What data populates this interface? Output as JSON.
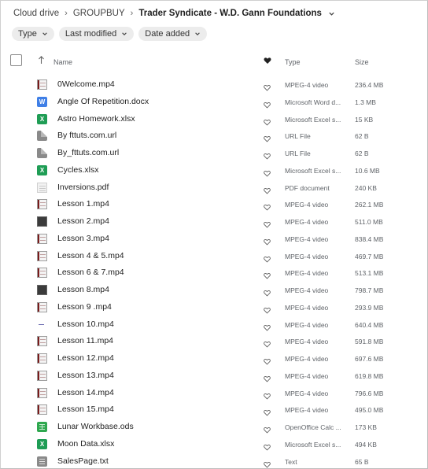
{
  "breadcrumb": {
    "items": [
      "Cloud drive",
      "GROUPBUY"
    ],
    "current": "Trader Syndicate - W.D. Gann Foundations"
  },
  "filters": [
    "Type",
    "Last modified",
    "Date added"
  ],
  "columns": {
    "name": "Name",
    "type": "Type",
    "size": "Size"
  },
  "files": [
    {
      "name": "0Welcome.mp4",
      "type": "MPEG-4 video",
      "size": "236.4 MB",
      "icon": "video-file-icon"
    },
    {
      "name": "Angle Of Repetition.docx",
      "type": "Microsoft Word d...",
      "size": "1.3 MB",
      "icon": "word-file-icon"
    },
    {
      "name": "Astro Homework.xlsx",
      "type": "Microsoft Excel s...",
      "size": "15 KB",
      "icon": "excel-file-icon"
    },
    {
      "name": "By fttuts.com.url",
      "type": "URL File",
      "size": "62 B",
      "icon": "url-file-icon"
    },
    {
      "name": "By_fttuts.com.url",
      "type": "URL File",
      "size": "62 B",
      "icon": "url-file-icon"
    },
    {
      "name": "Cycles.xlsx",
      "type": "Microsoft Excel s...",
      "size": "10.6 MB",
      "icon": "excel-file-icon"
    },
    {
      "name": "Inversions.pdf",
      "type": "PDF document",
      "size": "240 KB",
      "icon": "pdf-file-icon"
    },
    {
      "name": "Lesson 1.mp4",
      "type": "MPEG-4 video",
      "size": "262.1 MB",
      "icon": "video-file-icon"
    },
    {
      "name": "Lesson 2.mp4",
      "type": "MPEG-4 video",
      "size": "511.0 MB",
      "icon": "video-dark-file-icon"
    },
    {
      "name": "Lesson 3.mp4",
      "type": "MPEG-4 video",
      "size": "838.4 MB",
      "icon": "video-file-icon"
    },
    {
      "name": "Lesson 4 & 5.mp4",
      "type": "MPEG-4 video",
      "size": "469.7 MB",
      "icon": "video-file-icon"
    },
    {
      "name": "Lesson 6 & 7.mp4",
      "type": "MPEG-4 video",
      "size": "513.1 MB",
      "icon": "video-file-icon"
    },
    {
      "name": "Lesson 8.mp4",
      "type": "MPEG-4 video",
      "size": "798.7 MB",
      "icon": "video-dark-file-icon"
    },
    {
      "name": "Lesson 9 .mp4",
      "type": "MPEG-4 video",
      "size": "293.9 MB",
      "icon": "video-file-icon"
    },
    {
      "name": "Lesson 10.mp4",
      "type": "MPEG-4 video",
      "size": "640.4 MB",
      "icon": "video-dash-file-icon"
    },
    {
      "name": "Lesson 11.mp4",
      "type": "MPEG-4 video",
      "size": "591.8 MB",
      "icon": "video-file-icon"
    },
    {
      "name": "Lesson 12.mp4",
      "type": "MPEG-4 video",
      "size": "697.6 MB",
      "icon": "video-file-icon"
    },
    {
      "name": "Lesson 13.mp4",
      "type": "MPEG-4 video",
      "size": "619.8 MB",
      "icon": "video-file-icon"
    },
    {
      "name": "Lesson 14.mp4",
      "type": "MPEG-4 video",
      "size": "796.6 MB",
      "icon": "video-file-icon"
    },
    {
      "name": "Lesson 15.mp4",
      "type": "MPEG-4 video",
      "size": "495.0 MB",
      "icon": "video-file-icon"
    },
    {
      "name": "Lunar Workbase.ods",
      "type": "OpenOffice Calc ...",
      "size": "173 KB",
      "icon": "ods-file-icon"
    },
    {
      "name": "Moon Data.xlsx",
      "type": "Microsoft Excel s...",
      "size": "494 KB",
      "icon": "excel-file-icon"
    },
    {
      "name": "SalesPage.txt",
      "type": "Text",
      "size": "65 B",
      "icon": "text-file-icon"
    }
  ]
}
